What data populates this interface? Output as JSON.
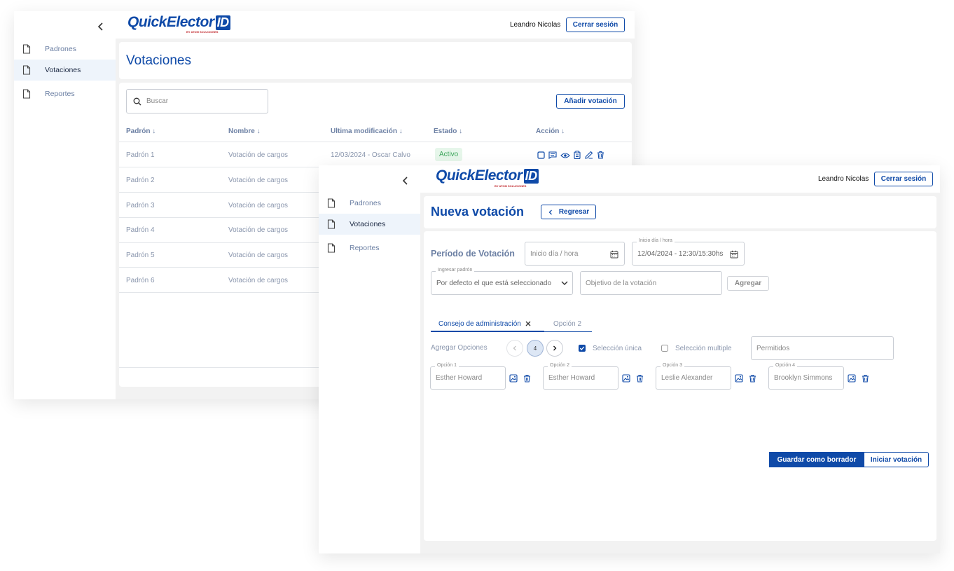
{
  "brand": {
    "name": "QuickElector",
    "id_mark": "ID",
    "tagline": "BY ATOM SOLUCIONES"
  },
  "user": {
    "name": "Leandro Nicolas",
    "logout_label": "Cerrar sesión"
  },
  "sidebar": {
    "items": [
      {
        "label": "Padrones"
      },
      {
        "label": "Votaciones"
      },
      {
        "label": "Reportes"
      }
    ]
  },
  "list_view": {
    "title": "Votaciones",
    "search_placeholder": "Buscar",
    "add_label": "Añadir votación",
    "columns": [
      "Padrón",
      "Nombre",
      "Ultima modificación",
      "Estado",
      "Acción"
    ],
    "rows": [
      {
        "padron": "Padrón 1",
        "nombre": "Votación de cargos",
        "modificacion": "12/03/2024 - Oscar Calvo",
        "estado": "Activo"
      },
      {
        "padron": "Padrón 2",
        "nombre": "Votación de cargos"
      },
      {
        "padron": "Padrón 3",
        "nombre": "Votación de cargos"
      },
      {
        "padron": "Padrón 4",
        "nombre": "Votación de cargos"
      },
      {
        "padron": "Padrón 5",
        "nombre": "Votación de cargos"
      },
      {
        "padron": "Padrón 6",
        "nombre": "Votación de cargos"
      }
    ]
  },
  "form_view": {
    "title": "Nueva votación",
    "back_label": "Regresar",
    "period_label": "Período de Votación",
    "start_placeholder": "Inicio día / hora",
    "start2_label": "Inicio día / hora",
    "start2_value": "12/04/2024 - 12:30/15:30hs",
    "padron_label": "Ingresar padrón",
    "padron_value": "Por defecto el que está seleccionado",
    "objective_placeholder": "Objetivo de la votación",
    "add_label": "Agregar",
    "tabs": [
      {
        "label": "Consejo de administración"
      },
      {
        "label": "Opción 2"
      }
    ],
    "options_label": "Agregar Opciones",
    "options_count": "4",
    "single_label": "Selección única",
    "multiple_label": "Selección multiple",
    "allowed_placeholder": "Permitidos",
    "options": [
      {
        "label": "Opción 1",
        "value": "Esther Howard"
      },
      {
        "label": "Opción 2",
        "value": "Esther Howard"
      },
      {
        "label": "Opción 3",
        "value": "Leslie Alexander"
      },
      {
        "label": "Opción 4",
        "value": "Brooklyn Simmons"
      }
    ],
    "save_draft_label": "Guardar como borrador",
    "start_vote_label": "Iniciar votación"
  },
  "colors": {
    "brand_blue": "#0f4aa8",
    "brand_red": "#c0282d",
    "active_green": "#3aa55a"
  }
}
